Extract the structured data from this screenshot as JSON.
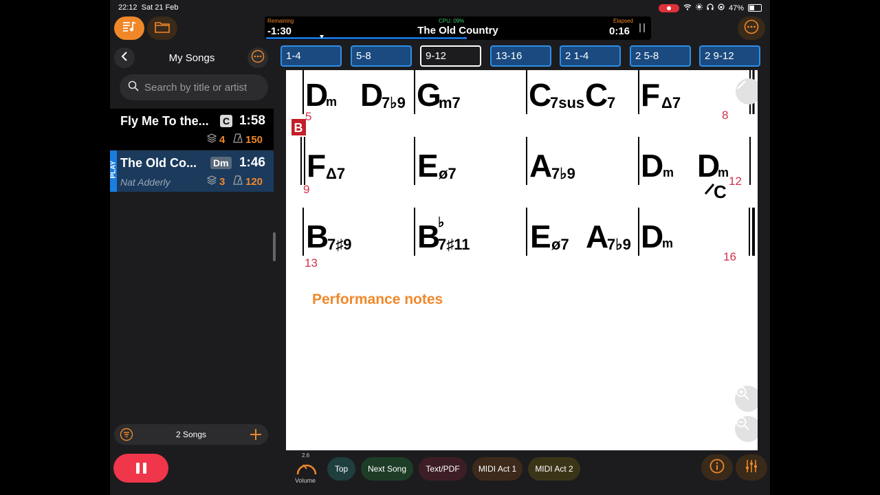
{
  "status_bar": {
    "time": "22:12",
    "date": "Sat 21 Feb",
    "battery": "47%"
  },
  "player": {
    "remaining_label": "Remaining",
    "remaining_value": "-1:30",
    "cpu": "CPU: 09%",
    "title": "The Old Country",
    "elapsed_label": "Elapsed",
    "elapsed_value": "0:16"
  },
  "sidebar": {
    "title": "My Songs",
    "search_placeholder": "Search by title or artist",
    "songs": [
      {
        "title": "Fly Me To the...",
        "key": "C",
        "duration": "1:58",
        "layers": "4",
        "bpm": "150",
        "artist": "",
        "playing": false
      },
      {
        "title": "The Old Co...",
        "key": "Dm",
        "duration": "1:46",
        "layers": "3",
        "bpm": "120",
        "artist": "Nat Adderly",
        "playing": true,
        "play_tag": "PLAY"
      }
    ],
    "count": "2 Songs"
  },
  "sections": [
    "1-4",
    "5-8",
    "9-12",
    "13-16",
    "2 1-4",
    "2 5-8",
    "2 9-12"
  ],
  "active_section": "9-12",
  "chart": {
    "section_marker": "B",
    "bar_numbers": [
      "5",
      "8",
      "9",
      "12",
      "13",
      "16"
    ],
    "rows": [
      [
        "Dm",
        "D7b9",
        "Gm7",
        "C7sus",
        "C7",
        "FΔ7"
      ],
      [
        "FΔ7",
        "Eø7",
        "A7b9",
        "Dm",
        "Dm/C"
      ],
      [
        "B7#9",
        "Bb7#11",
        "Eø7",
        "A7b9",
        "Dm"
      ]
    ],
    "performance_notes_label": "Performance notes"
  },
  "bottom": {
    "volume_value": "2.6",
    "volume_label": "Volume",
    "buttons": [
      "Top",
      "Next Song",
      "Text/PDF",
      "MIDI Act 1",
      "MIDI Act 2"
    ]
  },
  "colors": {
    "accent": "#f0882a",
    "blue": "#1a7ee0",
    "red": "#f0364a",
    "bar_number": "#d0304a"
  }
}
